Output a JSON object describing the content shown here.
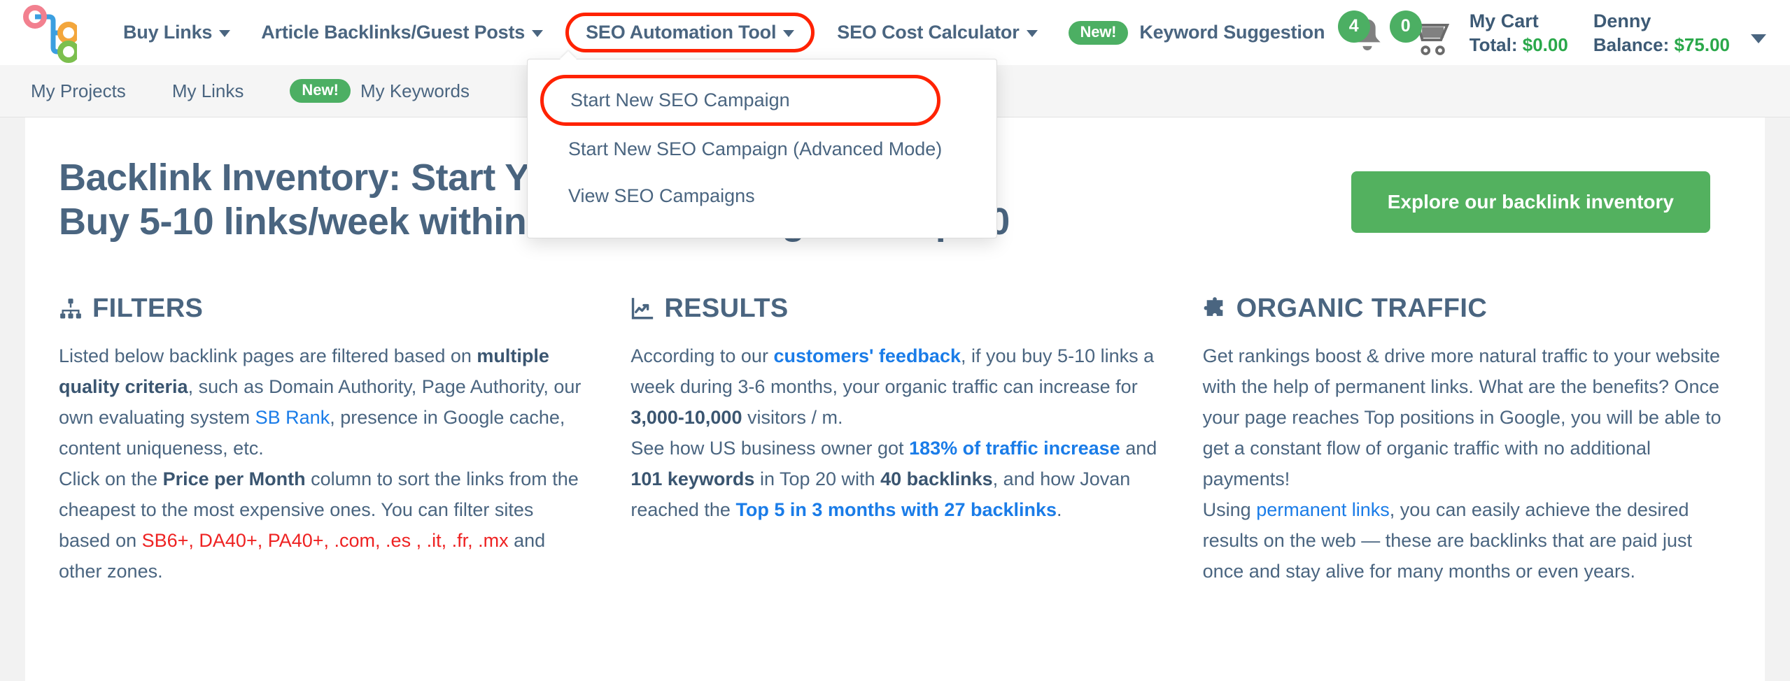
{
  "brand": {
    "logo_name": "sitebulb-network-logo"
  },
  "main_nav": [
    {
      "label": "Buy Links",
      "has_caret": true,
      "highlighted": false,
      "badge": null
    },
    {
      "label": "Article Backlinks/Guest Posts",
      "has_caret": true,
      "highlighted": false,
      "badge": null
    },
    {
      "label": "SEO Automation Tool",
      "has_caret": true,
      "highlighted": true,
      "badge": null
    },
    {
      "label": "SEO Cost Calculator",
      "has_caret": true,
      "highlighted": false,
      "badge": null
    },
    {
      "label": "Keyword Suggestion",
      "has_caret": false,
      "highlighted": false,
      "badge": "New!"
    }
  ],
  "header_right": {
    "notifications_count": "4",
    "cart_count": "0",
    "cart_title": "My Cart",
    "cart_total_label": "Total:",
    "cart_total_value": "$0.00",
    "user_name": "Denny",
    "balance_label": "Balance:",
    "balance_value": "$75.00"
  },
  "sub_nav": [
    {
      "label": "My Projects",
      "badge": null
    },
    {
      "label": "My Links",
      "badge": null
    },
    {
      "label": "My Keywords",
      "badge": "New!"
    }
  ],
  "dropdown": {
    "items": [
      {
        "label": "Start New SEO Campaign",
        "highlighted": true
      },
      {
        "label": "Start New SEO Campaign (Advanced Mode)",
        "highlighted": false
      },
      {
        "label": "View SEO Campaigns",
        "highlighted": false
      }
    ]
  },
  "hero": {
    "line1": "Backlink Inventory: Start Your SEO Campaign Here",
    "line2": "Buy 5-10 links/week within 3-6 months & get to Top 10",
    "cta_label": "Explore our backlink inventory"
  },
  "columns": [
    {
      "icon": "sitemap-icon",
      "title": "FILTERS",
      "paragraphs": [
        [
          {
            "t": "Listed below backlink pages are filtered based on ",
            "s": "plain"
          },
          {
            "t": "multiple quality criteria",
            "s": "bold"
          },
          {
            "t": ", such as Domain Authority, Page Authority, our own evaluating system ",
            "s": "plain"
          },
          {
            "t": "SB Rank",
            "s": "link"
          },
          {
            "t": ", presence in Google cache, content uniqueness, etc.",
            "s": "plain"
          }
        ],
        [
          {
            "t": "Click on the ",
            "s": "plain"
          },
          {
            "t": "Price per Month",
            "s": "bold"
          },
          {
            "t": " column to sort the links from the cheapest to the most expensive ones. You can filter sites based on ",
            "s": "plain"
          },
          {
            "t": "SB6+, DA40+, PA40+, .com, .es , .it, .fr, .mx",
            "s": "red"
          },
          {
            "t": " and other zones.",
            "s": "plain"
          }
        ]
      ]
    },
    {
      "icon": "chart-line-icon",
      "title": "RESULTS",
      "paragraphs": [
        [
          {
            "t": "According to our ",
            "s": "plain"
          },
          {
            "t": "customers' feedback",
            "s": "link-bold"
          },
          {
            "t": ", if you buy 5-10 links a week during 3-6 months, your organic traffic can increase for ",
            "s": "plain"
          },
          {
            "t": "3,000-10,000",
            "s": "bold"
          },
          {
            "t": " visitors / m.",
            "s": "plain"
          }
        ],
        [
          {
            "t": "See how US business owner got ",
            "s": "plain"
          },
          {
            "t": "183% of traffic increase",
            "s": "link-bold"
          },
          {
            "t": " and ",
            "s": "plain"
          },
          {
            "t": "101 keywords",
            "s": "bold"
          },
          {
            "t": " in Top 20 with ",
            "s": "plain"
          },
          {
            "t": "40 backlinks",
            "s": "bold"
          },
          {
            "t": ", and how Jovan reached the ",
            "s": "plain"
          },
          {
            "t": "Top 5 in 3 months with 27 backlinks",
            "s": "link-bold"
          },
          {
            "t": ".",
            "s": "plain"
          }
        ]
      ]
    },
    {
      "icon": "puzzle-piece-icon",
      "title": "ORGANIC TRAFFIC",
      "paragraphs": [
        [
          {
            "t": "Get rankings boost & drive more natural traffic to your website with the help of permanent links. What are the benefits? Once your page reaches Top positions in Google, you will be able to get a constant flow of organic traffic with no additional payments!",
            "s": "plain"
          }
        ],
        [
          {
            "t": "Using ",
            "s": "plain"
          },
          {
            "t": "permanent links",
            "s": "link"
          },
          {
            "t": ", you can easily achieve the desired results on the web — these are backlinks that are paid just once and stay alive for many months or even years.",
            "s": "plain"
          }
        ]
      ]
    }
  ],
  "colors": {
    "nav_text": "#4a6580",
    "accent_green": "#4caf63",
    "cta_green": "#53b15f",
    "link_blue": "#1a7ce8",
    "alert_red": "#ee2222",
    "highlight_ring": "#ff2200"
  }
}
